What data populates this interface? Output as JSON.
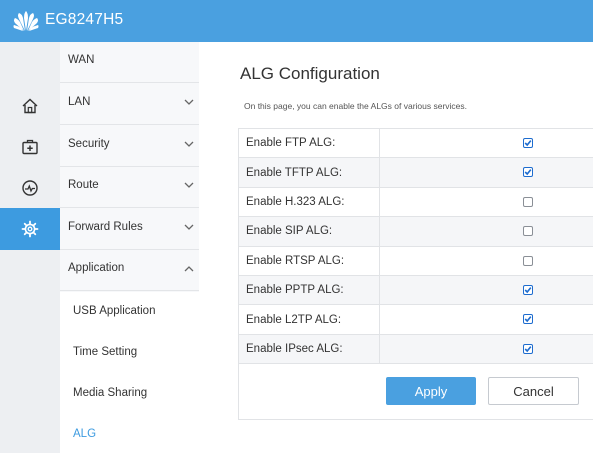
{
  "header": {
    "product_name": "EG8247H5",
    "logo_icon": "huawei-logo-icon",
    "bg_color": "#4aa0e0"
  },
  "icon_bar": [
    {
      "icon": "home-icon",
      "active": false
    },
    {
      "icon": "medical-kit-icon",
      "active": false
    },
    {
      "icon": "gauge-icon",
      "active": false
    },
    {
      "icon": "gear-icon",
      "active": true
    }
  ],
  "menu": [
    {
      "label": "WAN",
      "chevron": "none"
    },
    {
      "label": "LAN",
      "chevron": "down"
    },
    {
      "label": "Security",
      "chevron": "down"
    },
    {
      "label": "Route",
      "chevron": "down"
    },
    {
      "label": "Forward Rules",
      "chevron": "down"
    },
    {
      "label": "Application",
      "chevron": "up"
    }
  ],
  "submenu": [
    {
      "label": "USB Application",
      "active": false
    },
    {
      "label": "Time Setting",
      "active": false
    },
    {
      "label": "Media Sharing",
      "active": false
    },
    {
      "label": "ALG",
      "active": true
    }
  ],
  "page": {
    "title": "ALG Configuration",
    "description": "On this page, you can enable the ALGs of various services."
  },
  "alg_rows": [
    {
      "label": "Enable FTP ALG:",
      "checked": true
    },
    {
      "label": "Enable TFTP ALG:",
      "checked": true
    },
    {
      "label": "Enable H.323 ALG:",
      "checked": false
    },
    {
      "label": "Enable SIP ALG:",
      "checked": false
    },
    {
      "label": "Enable RTSP ALG:",
      "checked": false
    },
    {
      "label": "Enable PPTP ALG:",
      "checked": true
    },
    {
      "label": "Enable L2TP ALG:",
      "checked": true
    },
    {
      "label": "Enable IPsec ALG:",
      "checked": true
    }
  ],
  "buttons": {
    "apply": "Apply",
    "cancel": "Cancel"
  },
  "colors": {
    "accent": "#3d9be0",
    "button": "#4aa0e0"
  }
}
